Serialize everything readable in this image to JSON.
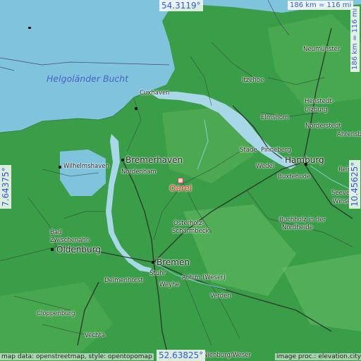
{
  "map": {
    "sea_label": "Helgoländer Bucht",
    "focus_place": "Oerel",
    "colors": {
      "sea": "#7fc4dc",
      "land": "#3a9e48",
      "land_light": "#6ec06a",
      "river": "#a8d8e8",
      "road_major": "#2a2a2a",
      "road_minor": "#5a5a5a",
      "focus": "#ff3333",
      "coord_text": "#3858d8"
    },
    "places": {
      "cuxhaven": "Cuxhaven",
      "bremerhaven": "Bremerhaven",
      "nordenham": "Nordenham",
      "wilhelmshaven": "Wilhelmshaven",
      "bad_zwischenahn_1": "Bad",
      "bad_zwischenahn_2": "Zwischenahn",
      "oldenburg": "Oldenburg",
      "bremen": "Bremen",
      "stuhr": "Stuhr",
      "delmenhorst": "Delmenhorst",
      "weyhe": "Weyhe",
      "achim": "Achim (Weser)",
      "verden": "Verden",
      "cloppenburg": "Cloppenburg",
      "vechta": "Vechta",
      "nienburg": "Nienburg/Weser",
      "osterholz_1": "Osterholz-",
      "osterholz_2": "Scharmbeck",
      "itzehoe": "Itzehoe",
      "neumuenster": "Neumünster",
      "elmshorn": "Elmshorn",
      "henstedt_1": "Henstedt-",
      "henstedt_2": "Ulzburg",
      "norderstedt": "Norderstedt",
      "ahrensburg": "Ahrensbu",
      "stade": "Stade",
      "pinneberg": "Pinneberg",
      "wedel": "Wedel",
      "hamburg": "Hamburg",
      "buxtehude": "Buxtehude",
      "seevetal": "Seevetal",
      "winsen": "Winse",
      "buchholz_1": "Buchholz in der",
      "buchholz_2": "Nordheide",
      "rein": "Rein"
    },
    "coords": {
      "top": "54.3119°",
      "bottom": "52.63825°",
      "left": "7.64375°",
      "right": "10.45625°"
    },
    "scale": {
      "horizontal": "186 km = 116 mi",
      "vertical": "186 km = 116 mi"
    },
    "attribution": {
      "left": "map data: openstreetmap, style: opentopomap",
      "right": "image proc.: elevation.city"
    }
  }
}
